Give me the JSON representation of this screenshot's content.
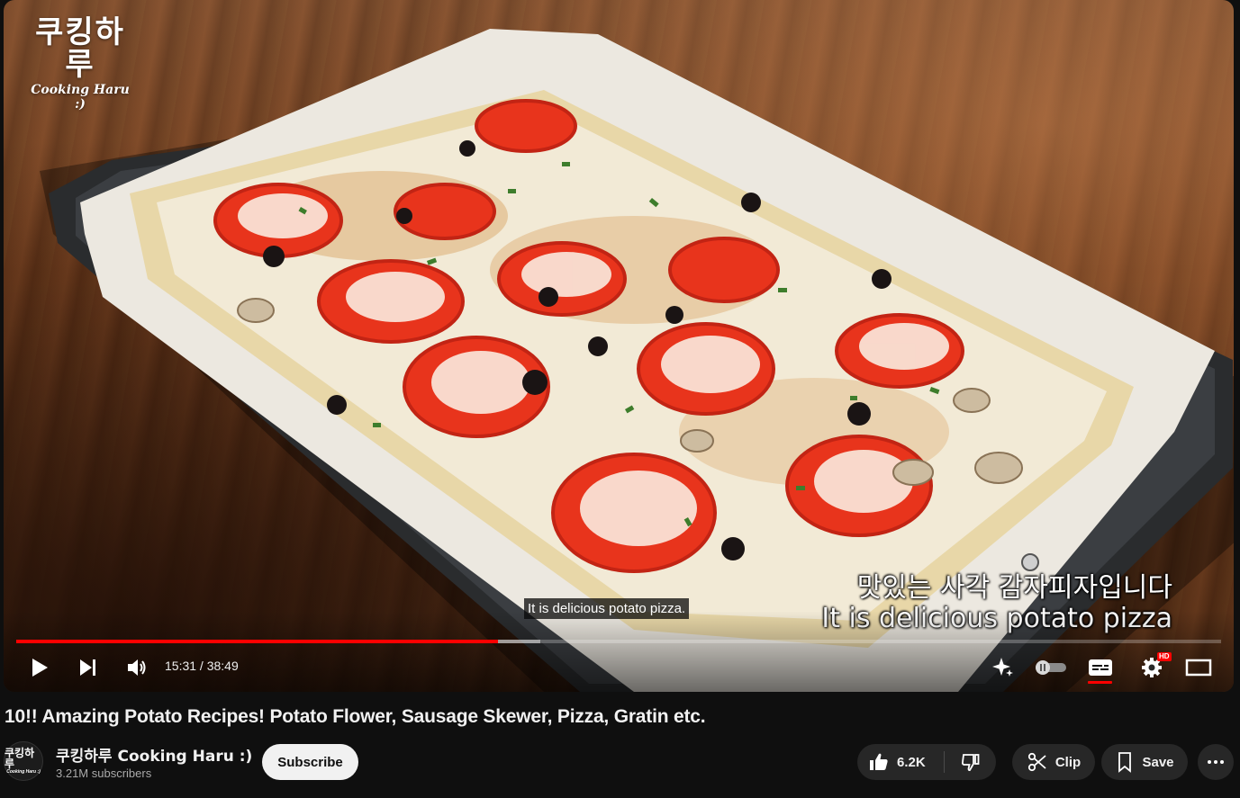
{
  "player": {
    "watermark_ko": "쿠킹하루",
    "watermark_en": "Cooking Haru :)",
    "burned_subtitle_ko": "맛있는 사각 감자피자입니다",
    "burned_subtitle_en": "It is delicious potato pizza",
    "closed_caption": "It is delicious potato pizza.",
    "time": "15:31 / 38:49",
    "progress_fraction": 0.4,
    "buffered_fraction": 0.435,
    "hd_badge": "HD",
    "controls": {
      "play_icon": "play-icon",
      "next_icon": "next-icon",
      "volume_icon": "volume-icon",
      "ai_icon": "sparkle-icon",
      "autoplay_icon": "autoplay-toggle-icon",
      "captions_icon": "captions-icon",
      "settings_icon": "gear-icon",
      "theater_icon": "theater-icon"
    }
  },
  "video": {
    "title": "10!! Amazing Potato Recipes! Potato Flower, Sausage Skewer, Pizza, Gratin etc."
  },
  "channel": {
    "avatar_ko": "쿠킹하루",
    "avatar_en": "Cooking Haru :)",
    "name": "쿠킹하루 Cooking Haru :)",
    "subscribers": "3.21M subscribers",
    "subscribe_label": "Subscribe"
  },
  "actions": {
    "like_count": "6.2K",
    "clip_label": "Clip",
    "save_label": "Save"
  },
  "colors": {
    "background": "#0f0f0f",
    "pill": "#272727",
    "accent_red": "#ff0000"
  }
}
